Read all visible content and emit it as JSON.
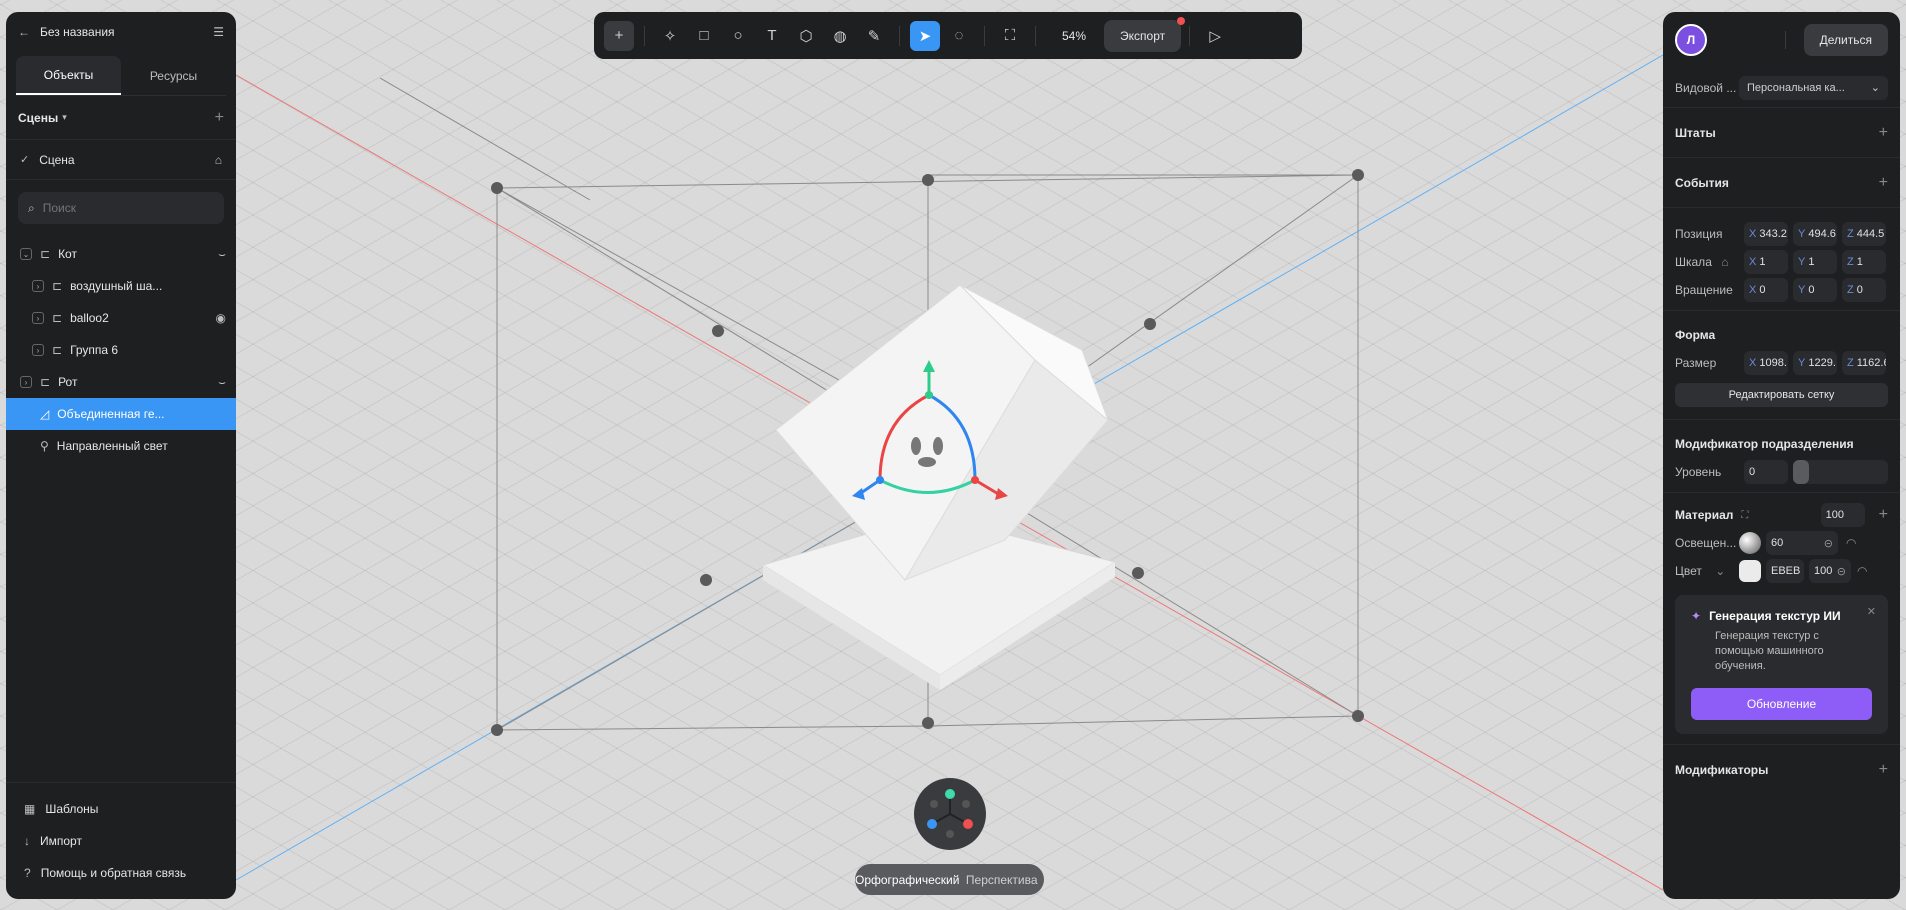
{
  "app": {
    "title": "Без названия"
  },
  "left": {
    "tabs": [
      {
        "label": "Объекты"
      },
      {
        "label": "Ресурсы"
      }
    ],
    "scenes_label": "Сцены",
    "scene_item": "Сцена",
    "search_placeholder": "Поиск",
    "tree": [
      {
        "label": "Кот"
      },
      {
        "label": "воздушный ша..."
      },
      {
        "label": "balloo2"
      },
      {
        "label": "Группа 6"
      },
      {
        "label": "Рот"
      },
      {
        "label": "Объединенная ге..."
      },
      {
        "label": "Направленный свет"
      }
    ],
    "bottom": [
      {
        "label": "Шаблоны"
      },
      {
        "label": "Импорт"
      },
      {
        "label": "Помощь и обратная связь"
      }
    ]
  },
  "toolbar": {
    "zoom": "54%",
    "export_label": "Экспорт"
  },
  "right": {
    "avatar_letter": "Л",
    "share_label": "Делиться",
    "view_label": "Видовой ...",
    "view_value": "Персональная ка...",
    "states_label": "Штаты",
    "events_label": "События",
    "position_label": "Позиция",
    "position": {
      "x": "343.2",
      "y": "494.6",
      "z": "444.5"
    },
    "scale_label": "Шкала",
    "scale": {
      "x": "1",
      "y": "1",
      "z": "1"
    },
    "rotation_label": "Вращение",
    "rotation": {
      "x": "0",
      "y": "0",
      "z": "0"
    },
    "shape_label": "Форма",
    "size_label": "Размер",
    "size": {
      "x": "1098.",
      "y": "1229.",
      "z": "1162.6"
    },
    "edit_mesh_label": "Редактировать сетку",
    "subdiv_label": "Модификатор подразделения",
    "level_label": "Уровень",
    "level_value": "0",
    "material_label": "Материал",
    "material_value": "100",
    "lighting_label": "Освещен...",
    "lighting_value": "60",
    "color_label": "Цвет",
    "color_hex": "EBEB",
    "color_value": "100",
    "ai_title": "Генерация текстур ИИ",
    "ai_desc": "Генерация текстур с помощью машинного обучения.",
    "ai_button": "Обновление",
    "modifiers_label": "Модификаторы",
    "axis_x": "X",
    "axis_y": "Y",
    "axis_z": "Z"
  },
  "view_toggle": {
    "ortho": "Орфографический",
    "persp": "Перспектива"
  },
  "colors": {
    "accent": "#3a96f4",
    "purple": "#8e5cf7",
    "panel": "#1e1f21"
  }
}
